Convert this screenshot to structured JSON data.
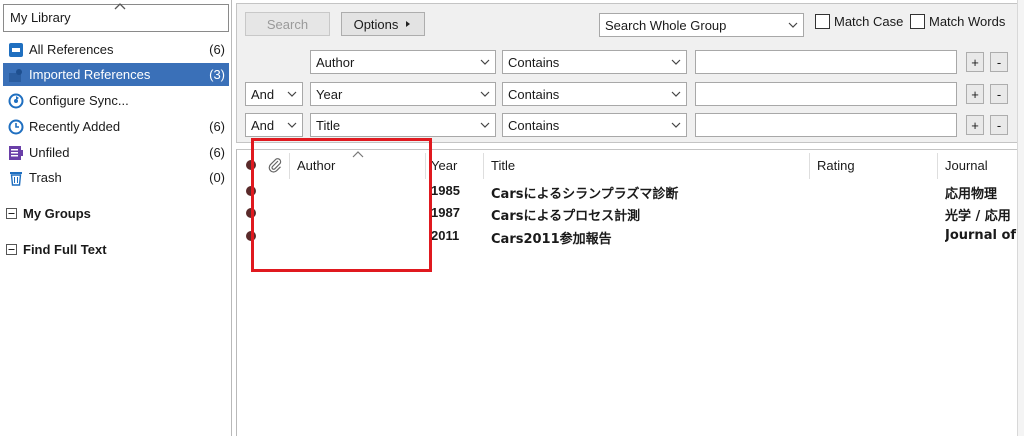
{
  "sidebar": {
    "library_label": "My Library",
    "items": [
      {
        "label": "All References",
        "count": "(6)"
      },
      {
        "label": "Imported References",
        "count": "(3)"
      },
      {
        "label": "Configure Sync...",
        "count": ""
      },
      {
        "label": "Recently Added",
        "count": "(6)"
      },
      {
        "label": "Unfiled",
        "count": "(6)"
      },
      {
        "label": "Trash",
        "count": "(0)"
      }
    ],
    "groups": [
      {
        "label": "My Groups"
      },
      {
        "label": "Find Full Text"
      }
    ]
  },
  "search": {
    "search_button": "Search",
    "options_button": "Options",
    "scope": "Search Whole Group",
    "match_case": "Match Case",
    "match_words": "Match Words",
    "rows": [
      {
        "connector": "",
        "field": "Author",
        "operator": "Contains",
        "value": ""
      },
      {
        "connector": "And",
        "field": "Year",
        "operator": "Contains",
        "value": ""
      },
      {
        "connector": "And",
        "field": "Title",
        "operator": "Contains",
        "value": ""
      }
    ],
    "plus": "+",
    "minus": "-"
  },
  "list": {
    "columns": {
      "author": "Author",
      "year": "Year",
      "title": "Title",
      "rating": "Rating",
      "journal": "Journal"
    },
    "rows": [
      {
        "year": "1985",
        "title": "Carsによるシランプラズマ診断",
        "journal": "応用物理"
      },
      {
        "year": "1987",
        "title": "Carsによるプロセス計測",
        "journal": "光学 / 応用"
      },
      {
        "year": "2011",
        "title": "Cars2011参加報告",
        "journal": "Journal of J"
      }
    ]
  },
  "colors": {
    "selected": "#3a70b8",
    "highlight": "#e0191f"
  }
}
